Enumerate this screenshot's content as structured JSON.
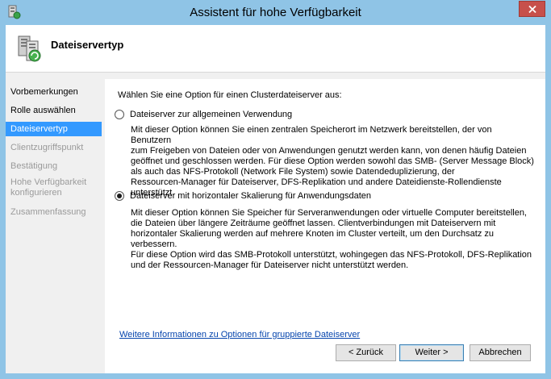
{
  "window": {
    "title": "Assistent für hohe Verfügbarkeit"
  },
  "header": {
    "title": "Dateiservertyp"
  },
  "nav": {
    "items": [
      {
        "label": "Vorbemerkungen",
        "state": "enabled"
      },
      {
        "label": "Rolle auswählen",
        "state": "enabled"
      },
      {
        "label": "Dateiservertyp",
        "state": "selected"
      },
      {
        "label": "Clientzugriffspunkt",
        "state": "disabled"
      },
      {
        "label": "Bestätigung",
        "state": "disabled"
      },
      {
        "label": "Hohe Verfügbarkeit konfigurieren",
        "state": "disabled"
      },
      {
        "label": "Zusammenfassung",
        "state": "disabled"
      }
    ]
  },
  "content": {
    "prompt": "Wählen Sie eine Option für einen Clusterdateiserver aus:",
    "options": [
      {
        "label": "Dateiserver zur allgemeinen Verwendung",
        "checked": false,
        "description": [
          "Mit dieser Option können Sie einen zentralen Speicherort im Netzwerk bereitstellen, der von Benutzern",
          "zum Freigeben von Dateien oder von Anwendungen genutzt werden kann, von denen häufig Dateien",
          "geöffnet und geschlossen werden. Für diese Option werden sowohl das SMB- (Server Message Block)",
          "als auch das NFS-Protokoll (Network File System) sowie Datendeduplizierung, der",
          "Ressourcen-Manager für Dateiserver, DFS-Replikation und andere Dateidienste-Rollendienste",
          "unterstützt."
        ]
      },
      {
        "label": "Dateiserver mit horizontaler Skalierung für Anwendungsdaten",
        "checked": true,
        "description": [
          "Mit dieser Option können Sie Speicher für Serveranwendungen oder virtuelle Computer bereitstellen,",
          "die Dateien über längere Zeiträume geöffnet lassen. Clientverbindungen mit Dateiservern mit",
          "horizontaler Skalierung werden auf mehrere Knoten im Cluster verteilt, um den Durchsatz zu verbessern.",
          "Für diese Option wird das SMB-Protokoll unterstützt, wohingegen das NFS-Protokoll, DFS-Replikation",
          "und der Ressourcen-Manager für Dateiserver nicht unterstützt werden."
        ]
      }
    ],
    "more_info_link": "Weitere Informationen zu Optionen für gruppierte Dateiserver"
  },
  "buttons": {
    "back": "< Zurück",
    "next": "Weiter >",
    "cancel": "Abbrechen"
  },
  "colors": {
    "titlebar": "#8fc4e6",
    "selected_nav": "#3399ff",
    "close_button": "#c7504b",
    "link": "#0645ad"
  }
}
